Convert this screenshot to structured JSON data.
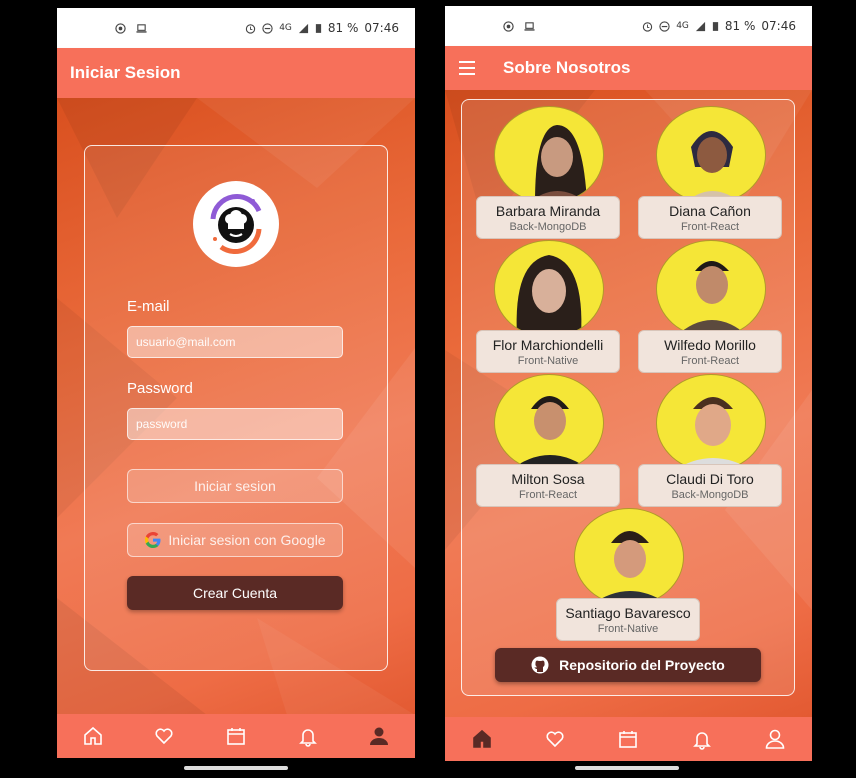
{
  "status_bar": {
    "network": "4G",
    "battery": "81 %",
    "time": "07:46"
  },
  "login_screen": {
    "title": "Iniciar Sesion",
    "email_label": "E-mail",
    "email_placeholder": "usuario@mail.com",
    "password_label": "Password",
    "password_placeholder": "password",
    "login_button": "Iniciar sesion",
    "google_button": "Iniciar sesion con Google",
    "create_button": "Crear Cuenta"
  },
  "about_screen": {
    "title": "Sobre Nosotros",
    "members": [
      {
        "name": "Barbara Miranda",
        "role": "Back-MongoDB"
      },
      {
        "name": "Diana Cañon",
        "role": "Front-React"
      },
      {
        "name": "Flor Marchiondelli",
        "role": "Front-Native"
      },
      {
        "name": "Wilfedo Morillo",
        "role": "Front-React"
      },
      {
        "name": "Milton Sosa",
        "role": "Front-React"
      },
      {
        "name": "Claudi Di Toro",
        "role": "Back-MongoDB"
      },
      {
        "name": "Santiago Bavaresco",
        "role": "Front-Native"
      }
    ],
    "repo_button": "Repositorio del Proyecto"
  },
  "nav_items": [
    "home-icon",
    "heart-icon",
    "calendar-icon",
    "bell-icon",
    "user-icon"
  ],
  "colors": {
    "appbar": "#f7705a",
    "accent_dark": "#5a2a25",
    "photo_bg": "#f5e637"
  }
}
